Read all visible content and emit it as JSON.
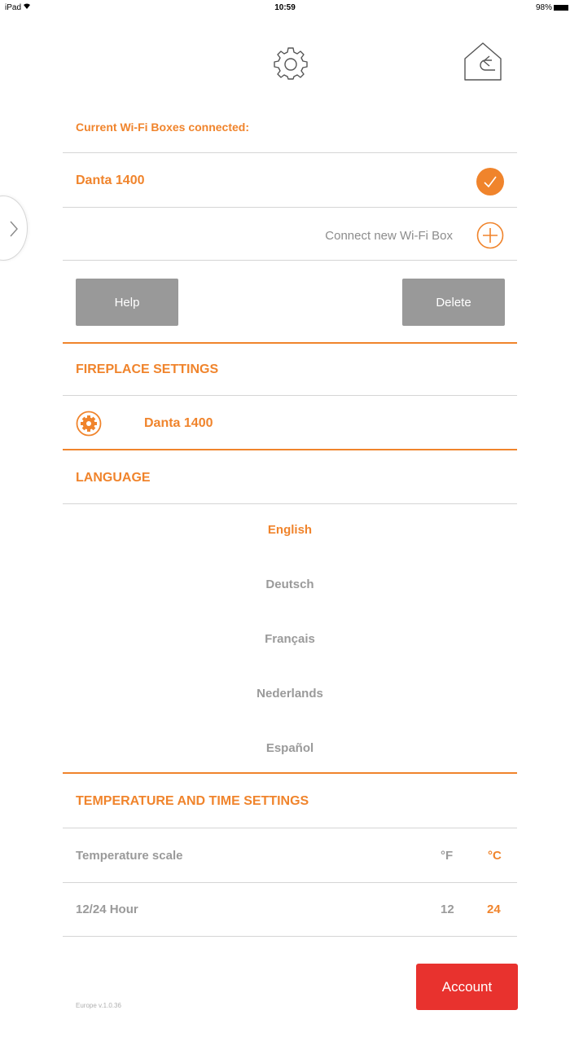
{
  "status_bar": {
    "device": "iPad",
    "time": "10:59",
    "battery": "98%"
  },
  "icons": {
    "settings": "gear-icon",
    "home": "home-exit-icon",
    "drawer": "chevron-right-icon",
    "connected": "check-icon",
    "add": "plus-circle-icon",
    "fireplace": "gear-filled-icon"
  },
  "wifi_boxes": {
    "title": "Current Wi-Fi Boxes connected:",
    "connected_box": "Danta 1400",
    "connect_new_label": "Connect new Wi-Fi Box",
    "help_label": "Help",
    "delete_label": "Delete"
  },
  "fireplace_settings": {
    "title": "FIREPLACE SETTINGS",
    "fireplace_name": "Danta 1400"
  },
  "language": {
    "title": "LANGUAGE",
    "options": [
      "English",
      "Deutsch",
      "Français",
      "Nederlands",
      "Español"
    ],
    "selected": "English"
  },
  "temp_time": {
    "title": "TEMPERATURE AND TIME SETTINGS",
    "scale_label": "Temperature scale",
    "scale_options": [
      "°F",
      "°C"
    ],
    "scale_selected": "°C",
    "hour_label": "12/24 Hour",
    "hour_options": [
      "12",
      "24"
    ],
    "hour_selected": "24"
  },
  "account_label": "Account",
  "version": "Europe v.1.0.36",
  "colors": {
    "accent": "#f0842c",
    "button_gray": "#999999",
    "account_red": "#e8322e"
  }
}
